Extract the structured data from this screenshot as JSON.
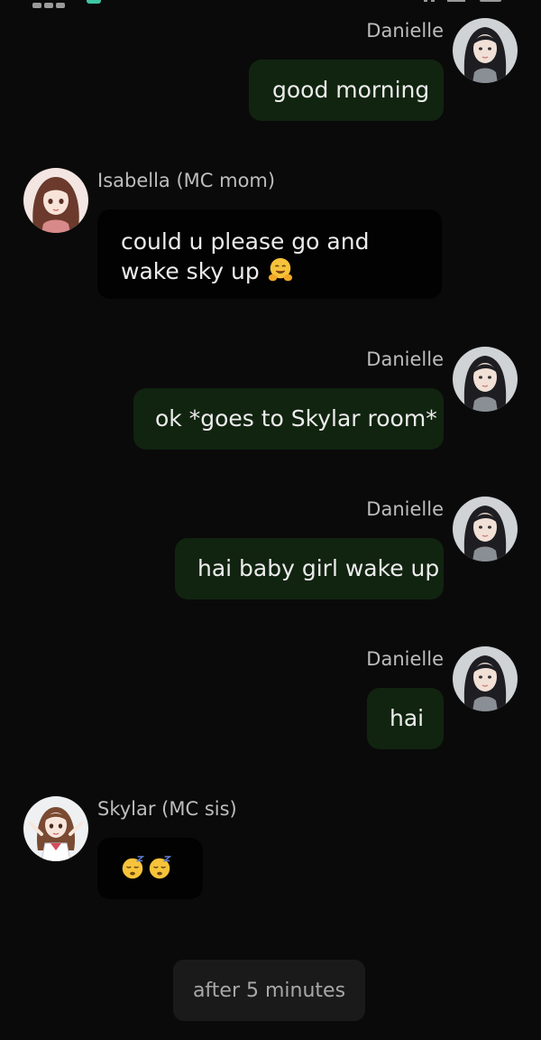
{
  "messages": [
    {
      "sender": "Danielle",
      "text": "good morning",
      "side": "right",
      "avatar": "danielle-avatar"
    },
    {
      "sender": "Isabella (MC mom)",
      "text": "could u please go and wake sky up",
      "emoji": "hugging-face-icon",
      "side": "left",
      "avatar": "isabella-avatar"
    },
    {
      "sender": "Danielle",
      "text": "ok *goes to Skylar room*",
      "side": "right",
      "avatar": "danielle-avatar"
    },
    {
      "sender": "Danielle",
      "text": "hai baby girl wake up",
      "side": "right",
      "avatar": "danielle-avatar"
    },
    {
      "sender": "Danielle",
      "text": "hai",
      "side": "right",
      "avatar": "danielle-avatar"
    },
    {
      "sender": "Skylar (MC sis)",
      "emoji": [
        "sleeping-face-icon",
        "sleeping-face-icon"
      ],
      "side": "left",
      "avatar": "skylar-avatar"
    }
  ],
  "system_notice": "after 5 minutes",
  "colors": {
    "background": "#0a0a0a",
    "outgoing_bubble": "#112410",
    "incoming_bubble": "#020202",
    "name_text": "#bdbdbd",
    "notice_pill": "#1a1a1a"
  }
}
